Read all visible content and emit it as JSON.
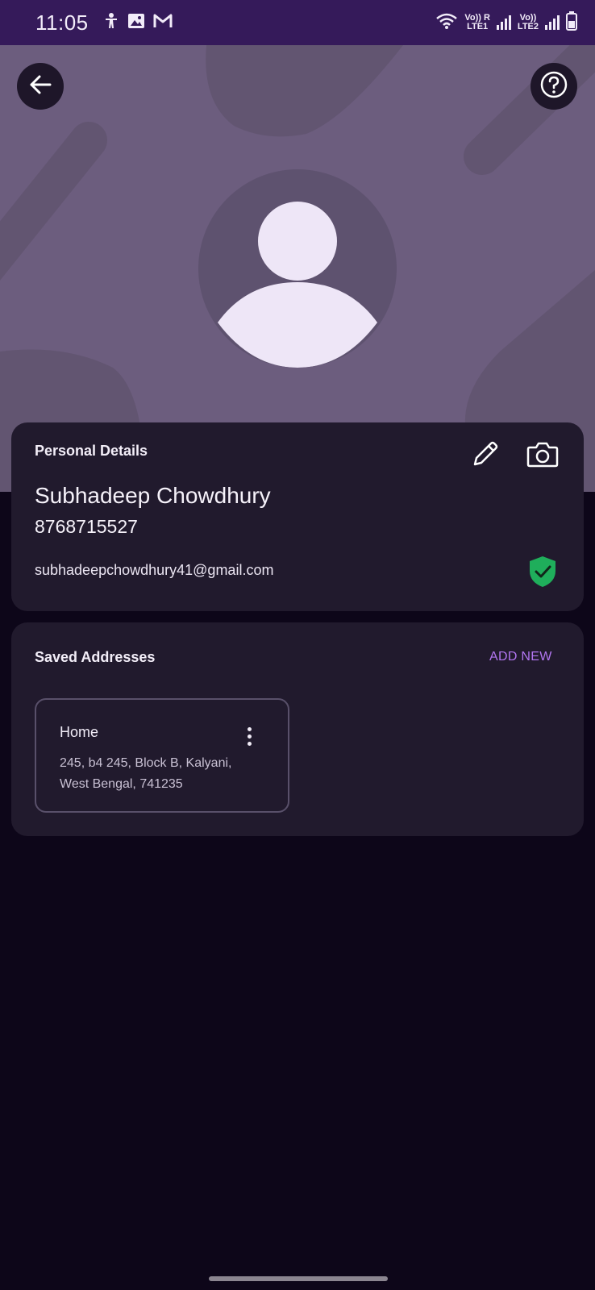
{
  "status_bar": {
    "time": "11:05",
    "notification_icons": [
      "accessibility-icon",
      "gallery-icon",
      "gmail-icon"
    ],
    "sim1_label_top": "Vo)) R",
    "sim1_label_bottom": "LTE1",
    "sim2_label_top": "Vo))",
    "sim2_label_bottom": "LTE2"
  },
  "header": {
    "back_icon": "arrow-left-icon",
    "help_icon": "question-icon"
  },
  "personal_details": {
    "title": "Personal Details",
    "name": "Subhadeep Chowdhury",
    "phone": "8768715527",
    "email": "subhadeepchowdhury41@gmail.com",
    "edit_icon": "pencil-icon",
    "camera_icon": "camera-icon",
    "verified_icon": "shield-check-icon",
    "verified_color": "#1fae5b"
  },
  "saved_addresses": {
    "title": "Saved Addresses",
    "add_new_label": "ADD NEW",
    "accent_color": "#b276f1",
    "items": [
      {
        "label": "Home",
        "line1": "245, b4 245, Block B, Kalyani,",
        "line2": "West Bengal, 741235"
      }
    ]
  }
}
